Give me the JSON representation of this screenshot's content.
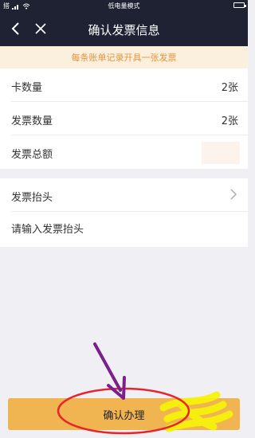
{
  "status_bar": {
    "left": "搭",
    "center": "低电量模式"
  },
  "nav": {
    "title": "确认发票信息"
  },
  "notice": "每条账单记录开具一张发票",
  "invoice_rows": [
    {
      "label": "卡数量",
      "value": "2张"
    },
    {
      "label": "发票数量",
      "value": "2张"
    },
    {
      "label": "发票总额",
      "value": ""
    }
  ],
  "invoice_title": {
    "label": "发票抬头",
    "input_placeholder": "请输入发票抬头"
  },
  "confirm_button": "确认办理",
  "colors": {
    "header_bg": "#1e2233",
    "notice_bg": "#fbf0dd",
    "notice_text": "#e8923a",
    "button_bg": "#f0b451",
    "annotation_arrow": "#7b1f8c",
    "annotation_circle": "#e8232a",
    "annotation_scribble": "#f5f20a"
  },
  "icons": [
    "signal-icon",
    "wifi-icon",
    "battery-icon",
    "back-arrow-icon",
    "close-icon",
    "chevron-right-icon"
  ]
}
